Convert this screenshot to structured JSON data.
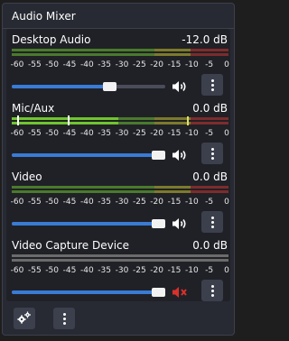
{
  "dock": {
    "title": "Audio Mixer"
  },
  "scale": [
    "-60",
    "-55",
    "-50",
    "-45",
    "-40",
    "-35",
    "-30",
    "-25",
    "-20",
    "-15",
    "-10",
    "-5",
    "0"
  ],
  "colors": {
    "meter_green": "#4a7a2c",
    "meter_yellow": "#7d7a2c",
    "meter_red": "#7d2c2c",
    "meter_green_active": "#6fc52f",
    "meter_grey": "#6b6b6b",
    "slider_fill": "#3a7bd5",
    "muted_icon": "#d9312b"
  },
  "channels": [
    {
      "name": "Desktop Audio",
      "db": "-12.0 dB",
      "volume": 0.65,
      "muted": false,
      "meter_style": "green-idle",
      "speaker_icon": "speaker-icon"
    },
    {
      "name": "Mic/Aux",
      "db": "0.0 dB",
      "volume": 1.0,
      "muted": false,
      "meter_style": "active",
      "speaker_icon": "speaker-icon"
    },
    {
      "name": "Video",
      "db": "0.0 dB",
      "volume": 1.0,
      "muted": false,
      "meter_style": "green-idle",
      "speaker_icon": "speaker-icon"
    },
    {
      "name": "Video Capture Device",
      "db": "0.0 dB",
      "volume": 1.0,
      "muted": true,
      "meter_style": "grey",
      "speaker_icon": "speaker-muted-icon"
    }
  ],
  "footer": {
    "settings_icon": "gear-icon",
    "menu_icon": "vertical-dots-icon"
  }
}
